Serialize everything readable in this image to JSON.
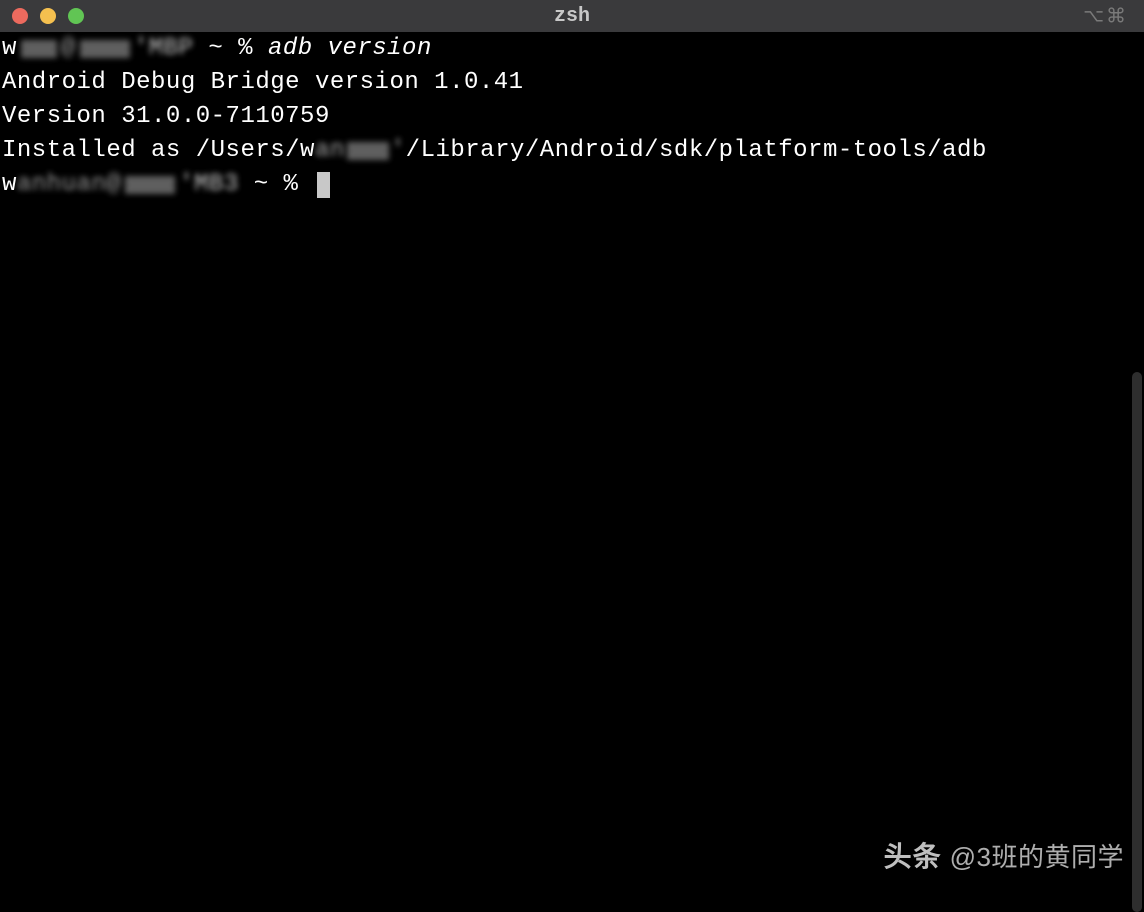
{
  "window": {
    "title": "zsh",
    "shortcut_hint": "⌥⌘"
  },
  "terminal": {
    "lines": [
      {
        "prompt_prefix": "w",
        "prompt_mid_hidden_parts": [
          "   ",
          "@",
          "  ",
          " MBP"
        ],
        "prompt_suffix": " ~ % ",
        "command": "adb version",
        "command_italic": true
      },
      {
        "text": "Android Debug Bridge version 1.0.41"
      },
      {
        "text": "Version 31.0.0-7110759"
      },
      {
        "prefix": "Installed as /Users/w",
        "hidden_part": "      ",
        "suffix": "/Library/Android/sdk/platform-tools/adb"
      },
      {
        "prompt_prefix": "w",
        "prompt_hidden": "       @    MBP",
        "prompt_suffix": " ~ % ",
        "has_cursor": true
      }
    ]
  },
  "watermark": {
    "logo": "头条",
    "handle": "@3班的黄同学"
  }
}
